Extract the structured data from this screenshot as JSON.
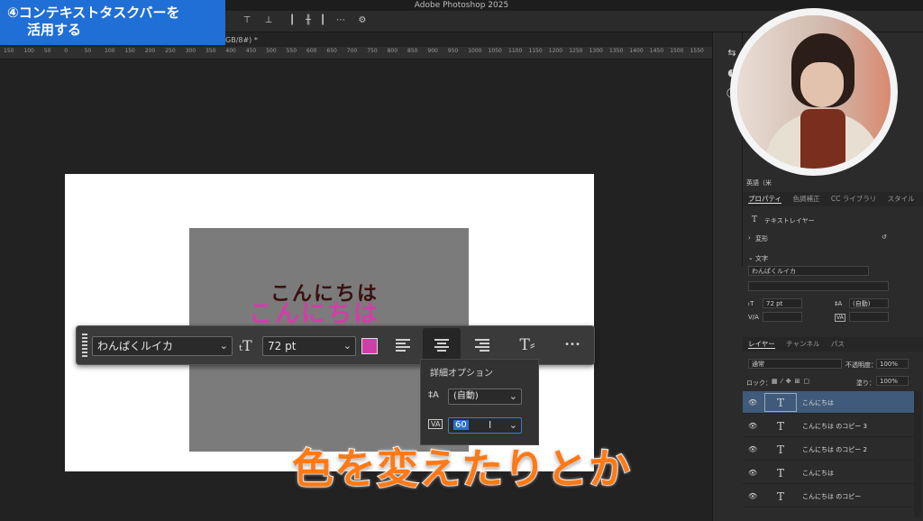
{
  "app_title": "Adobe Photoshop 2025",
  "banner": {
    "line1": "④コンテキストタスクバーを",
    "line2": "活用する"
  },
  "doc_tab": "GB/8#) *",
  "ruler_labels": [
    "150",
    "100",
    "50",
    "0",
    "50",
    "100",
    "150",
    "200",
    "250",
    "300",
    "350",
    "400",
    "450",
    "500",
    "550",
    "600",
    "650",
    "700",
    "750",
    "800",
    "850",
    "900",
    "950",
    "1000",
    "1050",
    "1100",
    "1150",
    "1200",
    "1250",
    "1300",
    "1350",
    "1400",
    "1450",
    "1500",
    "1550"
  ],
  "canvas": {
    "text_black": "こんにちは",
    "text_pink": "こんにちは",
    "text_color": "#d23ea8"
  },
  "taskbar": {
    "font_value": "わんぱくルイカ",
    "font_icon": "font-size-icon",
    "size_value": "72 pt",
    "swatch_color": "#d23ea8",
    "more_label": "•••"
  },
  "advanced": {
    "title": "詳細オプション",
    "leading_value": "(自動)",
    "tracking_value": "60"
  },
  "right_panel": {
    "font_label": "英語（米",
    "tabs": [
      "プロパティ",
      "色調補正",
      "CC ライブラリ",
      "スタイル"
    ],
    "text_layer_label": "テキストレイヤー",
    "transform_label": "変形",
    "char_label": "文字",
    "font_value": "わんぱくルイカ",
    "size_value": "72 pt",
    "leading_value": "(自動)",
    "va_label": "V/A",
    "layer_tabs": [
      "レイヤー",
      "チャンネル",
      "パス"
    ],
    "blend_mode": "通常",
    "opacity_label": "不透明度：",
    "opacity_value": "100%",
    "lock_label": "ロック：",
    "fill_label": "塗り：",
    "fill_value": "100%"
  },
  "layers": [
    {
      "name": "こんにちは",
      "selected": true
    },
    {
      "name": "こんにちは のコピー 3",
      "selected": false
    },
    {
      "name": "こんにちは のコピー 2",
      "selected": false
    },
    {
      "name": "こんにちは",
      "selected": false
    },
    {
      "name": "こんにちは のコピー",
      "selected": false
    }
  ],
  "caption": "色を変えたりとか"
}
